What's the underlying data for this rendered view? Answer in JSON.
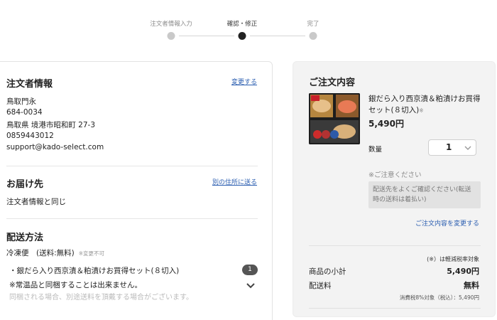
{
  "stepper": {
    "steps": [
      {
        "label": "注文者情報入力",
        "active": false
      },
      {
        "label": "確認・修正",
        "active": true
      },
      {
        "label": "完了",
        "active": false
      }
    ]
  },
  "orderer": {
    "title": "注文者情報",
    "change_link": "変更する",
    "name": "鳥取門永",
    "postal": "684-0034",
    "address": "鳥取県 境港市昭和町 27-3",
    "phone": "0859443012",
    "email": "support@kado-select.com"
  },
  "delivery_dest": {
    "title": "お届け先",
    "link": "別の住所に送る",
    "value": "注文者情報と同じ"
  },
  "shipping": {
    "title": "配送方法",
    "method": "冷凍便　(送料:無料)",
    "note": "※変更不可",
    "item": "・銀だら入り西京漬＆粕漬けお買得セット(８切入)",
    "item_count": "1",
    "warning": "※常温品と同梱することは出来ません。",
    "cut_text": "同梱される場合、別途送料を頂戴する場合がございます。"
  },
  "order_summary": {
    "title": "ご注文内容",
    "product_name": "銀だら入り西京漬＆粕漬けお買得セット(８切入)",
    "product_asterisk": "※",
    "price": "5,490円",
    "qty_label": "数量",
    "qty_value": "1",
    "notice_title": "※ご注意ください",
    "notice_text": "配送先をよくご確認ください(転送時の送料は着払い)",
    "change_link": "ご注文内容を変更する",
    "tax_note": "(※）は軽減税率対象",
    "subtotal_label": "商品の小計",
    "subtotal_value": "5,490円",
    "shipping_label": "配送料",
    "shipping_value": "無料",
    "tax_detail": "消費税8%対象（税込）：5,490円"
  },
  "colors": {
    "link": "#2a5db0",
    "right_panel_bg": "#f3f3f3",
    "active_dot": "#222222",
    "inactive_dot": "#c9c9c9"
  }
}
